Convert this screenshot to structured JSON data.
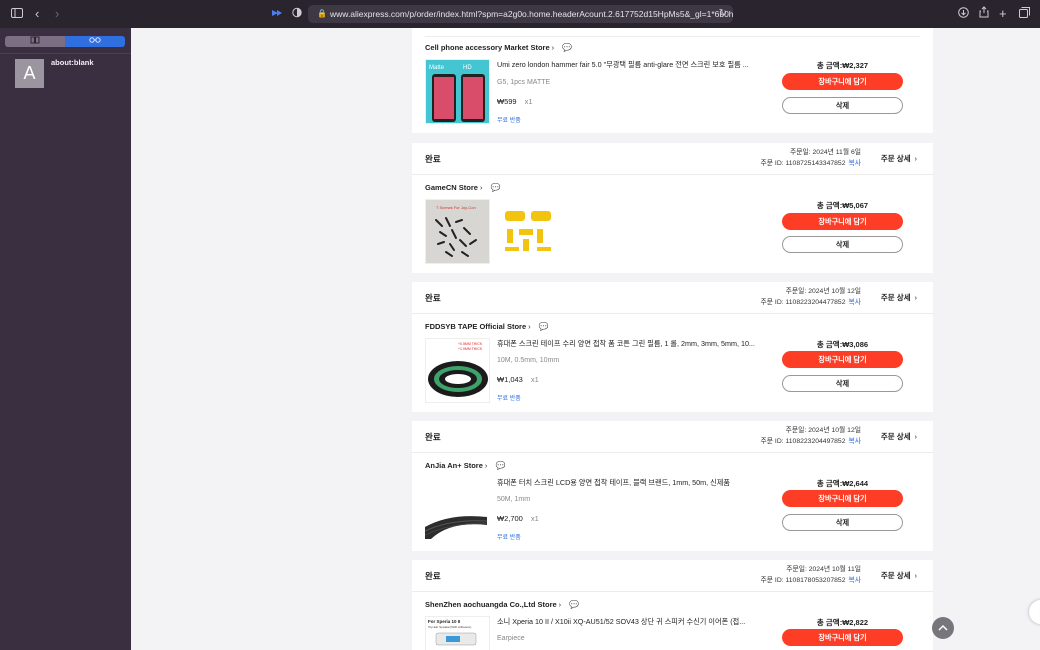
{
  "browser": {
    "url": "www.aliexpress.com/p/order/index.html?spm=a2g0o.home.headerAcount.2.617752d15HpMs5&_gl=1*6b0huw*_gcl_"
  },
  "sidebar": {
    "tab_title": "about:blank",
    "tab_avatar": "A"
  },
  "orders": [
    {
      "store": "Cell phone accessory Market Store",
      "product_title": "Umi zero london hammer fair 5.0 \"무광택 필름 anti-glare 전면 스크린 보호 필름 ...",
      "variant": "G5, 1pcs MATTE",
      "price": "₩599",
      "qty": "x1",
      "return_label": "무료 반품",
      "total": "총 금액:₩2,327",
      "cart_label": "장바구니에 담기",
      "delete_label": "삭제"
    },
    {
      "status": "완료",
      "date": "주문일: 2024년 11월 6일",
      "order_id": "주문 ID: 1108725143347852",
      "copy_label": "복사",
      "details_label": "주문 상세",
      "store": "GameCN Store",
      "total": "총 금액:₩5,067",
      "cart_label": "장바구니에 담기",
      "delete_label": "삭제"
    },
    {
      "status": "완료",
      "date": "주문일: 2024년 10월 12일",
      "order_id": "주문 ID: 1108223204477852",
      "copy_label": "복사",
      "details_label": "주문 상세",
      "store": "FDDSYB TAPE Official Store",
      "product_title": "휴대폰 스크린 테이프 수리 양면 접착 폼 코튼 그린 필름, 1 롤, 2mm, 3mm, 5mm, 10...",
      "variant": "10M, 0.5mm, 10mm",
      "price": "₩1,043",
      "qty": "x1",
      "return_label": "무료 반품",
      "total": "총 금액:₩3,086",
      "cart_label": "장바구니에 담기",
      "delete_label": "삭제"
    },
    {
      "status": "완료",
      "date": "주문일: 2024년 10월 12일",
      "order_id": "주문 ID: 1108223204497852",
      "copy_label": "복사",
      "details_label": "주문 상세",
      "store": "AnJia An+ Store",
      "product_title": "휴대폰 터치 스크린 LCD용 양면 접착 테이프, 블랙 브랜드, 1mm, 50m, 신제품",
      "variant": "50M, 1mm",
      "price": "₩2,700",
      "qty": "x1",
      "return_label": "무료 반품",
      "total": "총 금액:₩2,644",
      "cart_label": "장바구니에 담기",
      "delete_label": "삭제"
    },
    {
      "status": "완료",
      "date": "주문일: 2024년 10월 11일",
      "order_id": "주문 ID: 1108178053207852",
      "copy_label": "복사",
      "details_label": "주문 상세",
      "store": "ShenZhen aochuangda Co.,Ltd Store",
      "product_title": "소니 Xperia 10 II / X10ii XQ-AU51/52 SOV43 상단 귀 스피커 수신기 이어폰 (접...",
      "variant": "Earpiece",
      "total": "총 금액:₩2,822",
      "cart_label": "장바구니에 담기"
    }
  ],
  "images": {
    "gamecn_thumb_caption": "T Screws For Joy-Con",
    "tape_thumb_caption_1": "+0.5MM THICK",
    "tape_thumb_caption_2": "+1.0MM THICK",
    "xperia_thumb_caption_1": "For Xperia 10 II",
    "xperia_thumb_caption_2": "Top Ear Speaker(With Adhesive)",
    "matte_thumb_label_1": "Matte",
    "matte_thumb_label_2": "HD"
  },
  "colors": {
    "accent_red": "#fd3d25",
    "link_blue": "#2a6bd8",
    "sidebar_bg": "#3a2f40"
  }
}
